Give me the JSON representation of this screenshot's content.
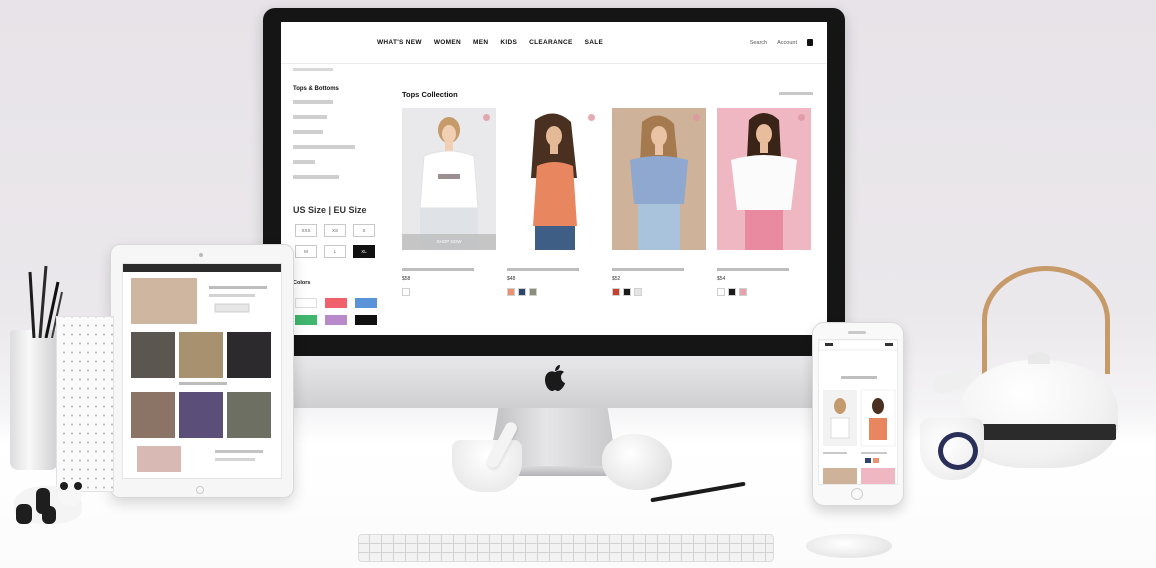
{
  "store": {
    "nav": [
      "WHAT'S NEW",
      "WOMEN",
      "MEN",
      "KIDS",
      "CLEARANCE",
      "SALE"
    ],
    "nav_right": [
      "Search",
      "Account"
    ],
    "sidebar_title": "Tops & Bottoms",
    "size_title": "US Size  |  EU Size",
    "sizes": [
      "XXS",
      "XS",
      "S",
      "M",
      "L",
      "XL"
    ],
    "selected_size": "XL",
    "color_title": "Colors",
    "section_title": "Tops Collection",
    "shop_label": "SHOP NOW",
    "card_prices": [
      "$58",
      "$48",
      "$52",
      "$54"
    ]
  },
  "palette": {
    "filter_colors": [
      "#ffffff",
      "#f0616e",
      "#5a93d8",
      "#3fb66c",
      "#b98ac9",
      "#111111"
    ],
    "card_swatches": [
      [
        "#ffffff"
      ],
      [
        "#e99372",
        "#2e466b",
        "#8a8f7a"
      ],
      [
        "#c6422f",
        "#1a1a1a",
        "#e5e5e5"
      ],
      [
        "#ffffff",
        "#1c1c1c",
        "#e7a3ad"
      ]
    ],
    "photo_backgrounds": [
      "#e9e9ec",
      "#ffffff",
      "#cfb29a",
      "#efb7c2"
    ]
  }
}
